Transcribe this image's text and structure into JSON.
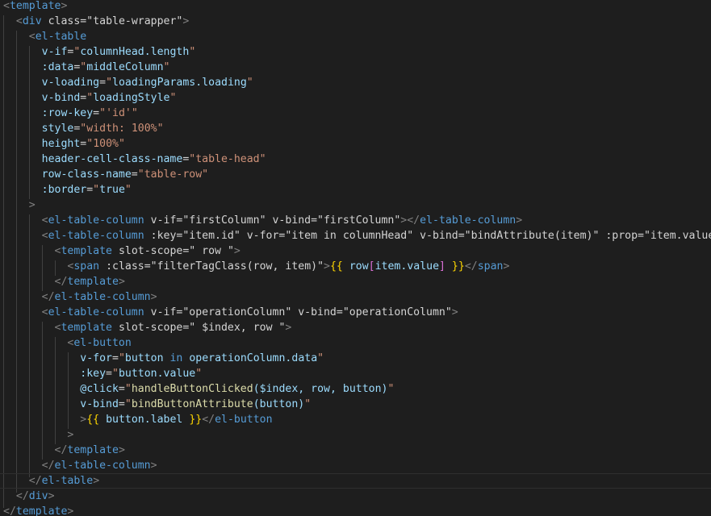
{
  "editor": {
    "language": "vue-template",
    "current_line": 31,
    "colors": {
      "background": "#1e1e1e",
      "tag": "#569cd6",
      "bracket": "#808080",
      "attribute": "#9cdcfe",
      "string": "#ce9178",
      "function": "#dcdcaa",
      "mustache": "#ffd700",
      "square_bracket": "#da70d6"
    },
    "lines": [
      "<template>",
      "  <div class=\"table-wrapper\">",
      "    <el-table",
      "      v-if=\"columnHead.length\"",
      "      :data=\"middleColumn\"",
      "      v-loading=\"loadingParams.loading\"",
      "      v-bind=\"loadingStyle\"",
      "      :row-key=\"'id'\"",
      "      style=\"width: 100%\"",
      "      height=\"100%\"",
      "      header-cell-class-name=\"table-head\"",
      "      row-class-name=\"table-row\"",
      "      :border=\"true\"",
      "    >",
      "      <el-table-column v-if=\"firstColumn\" v-bind=\"firstColumn\"></el-table-column>",
      "      <el-table-column :key=\"item.id\" v-for=\"item in columnHead\" v-bind=\"bindAttribute(item)\" :prop=\"item.value\">",
      "        <template slot-scope=\"{ row }\">",
      "          <span :class=\"filterTagClass(row, item)\">{{ row[item.value] }}</span>",
      "        </template>",
      "      </el-table-column>",
      "      <el-table-column v-if=\"operationColumn\" v-bind=\"operationColumn\">",
      "        <template slot-scope=\"{ $index, row }\">",
      "          <el-button",
      "            v-for=\"button in operationColumn.data\"",
      "            :key=\"button.value\"",
      "            @click=\"handleButtonClicked($index, row, button)\"",
      "            v-bind=\"bindButtonAttribute(button)\"",
      "            >{{ button.label }}</el-button",
      "          >",
      "        </template>",
      "      </el-table-column>",
      "    </el-table>",
      "  </div>",
      "</template>"
    ]
  }
}
